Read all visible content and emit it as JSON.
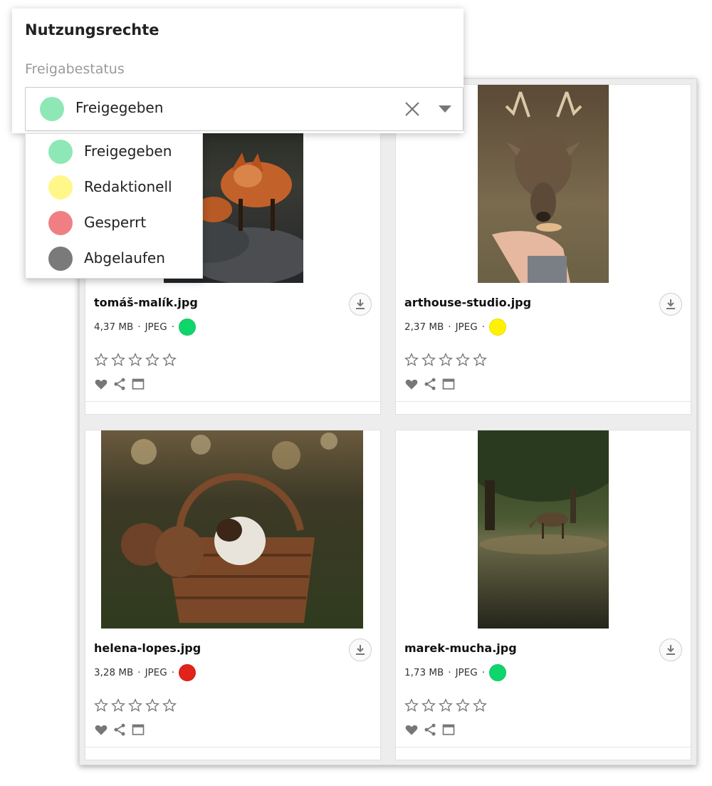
{
  "rights": {
    "title": "Nutzungsrechte",
    "field_label": "Freigabestatus",
    "selected": {
      "label": "Freigegeben",
      "color": "#8de8b6"
    },
    "options": [
      {
        "label": "Freigegeben",
        "color": "#8de8b6"
      },
      {
        "label": "Redaktionell",
        "color": "#fff78a"
      },
      {
        "label": "Gesperrt",
        "color": "#ef7f83"
      },
      {
        "label": "Abgelaufen",
        "color": "#7a7a7a"
      }
    ]
  },
  "assets": [
    {
      "filename": "tomáš-malík.jpg",
      "size": "4,37 MB",
      "type": "JPEG",
      "status_color": "#0fd66b",
      "rating": 0
    },
    {
      "filename": "arthouse-studio.jpg",
      "size": "2,37 MB",
      "type": "JPEG",
      "status_color": "#fff200",
      "rating": 0
    },
    {
      "filename": "helena-lopes.jpg",
      "size": "3,28 MB",
      "type": "JPEG",
      "status_color": "#e2231a",
      "rating": 0
    },
    {
      "filename": "marek-mucha.jpg",
      "size": "1,73 MB",
      "type": "JPEG",
      "status_color": "#0fd66b",
      "rating": 0
    }
  ],
  "icons": {
    "download": "download-icon",
    "star": "star-outline-icon",
    "favorite": "heart-icon",
    "share": "share-icon",
    "preview": "window-icon",
    "clear": "close-icon",
    "dropdown": "caret-down-icon"
  },
  "separator": "·"
}
